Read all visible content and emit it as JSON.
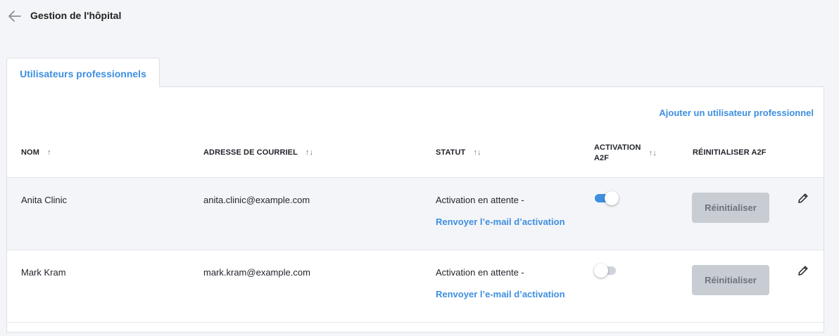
{
  "header": {
    "title": "Gestion de l'hôpital",
    "back_icon": "arrow-left-icon"
  },
  "tabs": [
    {
      "label": "Utilisateurs professionnels",
      "active": true
    }
  ],
  "add_link": "Ajouter un utilisateur professionnel",
  "columns": {
    "name": "NOM",
    "email": "ADRESSE DE COURRIEL",
    "status": "STATUT",
    "activation_line1": "ACTIVATION",
    "activation_line2": "A2F",
    "reset": "RÉINITIALISER A2F"
  },
  "rows": [
    {
      "name": "Anita Clinic",
      "email": "anita.clinic@example.com",
      "status": "Activation en attente -",
      "resend": "Renvoyer l’e-mail d’activation",
      "a2f_enabled": true,
      "reset_label": "Réinitialiser"
    },
    {
      "name": "Mark Kram",
      "email": "mark.kram@example.com",
      "status": "Activation en attente -",
      "resend": "Renvoyer l’e-mail d’activation",
      "a2f_enabled": false,
      "reset_label": "Réinitialiser"
    }
  ],
  "colors": {
    "accent": "#3d8fe0",
    "toggle_on": "#3d8fe0",
    "button_disabled": "#c8ccd3"
  }
}
